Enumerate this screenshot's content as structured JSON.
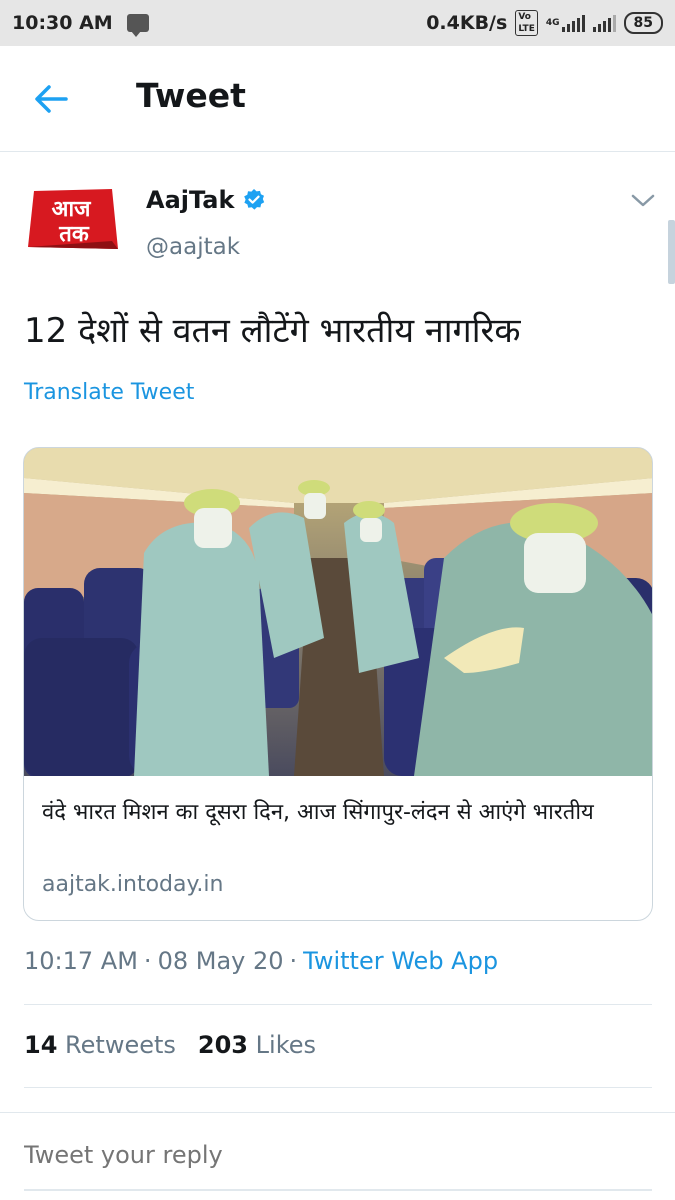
{
  "status_bar": {
    "time": "10:30 AM",
    "net_speed": "0.4KB/s",
    "volte": "Vo LTE",
    "network": "4G",
    "battery": "85"
  },
  "header": {
    "title": "Tweet",
    "back_icon": "arrow-left-icon"
  },
  "tweet": {
    "author": {
      "display_name": "AajTak",
      "handle": "@aajtak",
      "verified": true,
      "avatar_text": "आज तक"
    },
    "text": "12 देशों से वतन लौटेंगे भारतीय नागरिक",
    "translate_label": "Translate Tweet",
    "card": {
      "title": "वंदे भारत मिशन का दूसरा दिन, आज सिंगापुर-लंदन से आएंगे भारतीय",
      "domain": "aajtak.intoday.in"
    },
    "time": "10:17 AM",
    "date": "08 May 20",
    "source": "Twitter Web App",
    "retweets_count": "14",
    "retweets_label": "Retweets",
    "likes_count": "203",
    "likes_label": "Likes"
  },
  "reply": {
    "placeholder": "Tweet your reply"
  },
  "colors": {
    "accent": "#1b95e0",
    "secondary_text": "#657786",
    "border": "#e1e8ed"
  }
}
